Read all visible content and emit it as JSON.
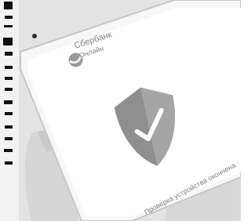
{
  "image": {
    "kind": "photo",
    "subject": "hand-holding-smartphone-with-security-shield",
    "palette": {
      "background": "#e6e6e6",
      "phone_frame": "#f4f4f4",
      "screen": "#ffffff",
      "shield": "#8f8f8f",
      "hand": "#dcdcdc",
      "left_strip": "#111111"
    }
  },
  "app": {
    "logo_name": "Сбербанк",
    "logo_sub": "Онлайн"
  },
  "screen": {
    "status_text": "Проверка устройства окончена"
  },
  "icons": {
    "logo": "sber-logo-icon",
    "shield": "shield-check-icon"
  }
}
